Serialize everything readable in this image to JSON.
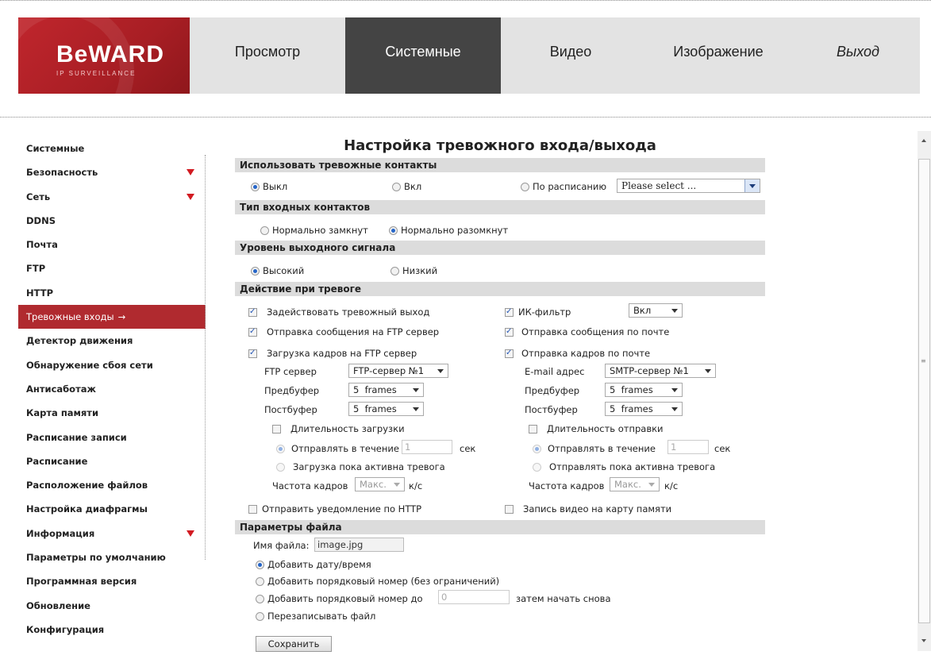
{
  "header": {
    "brand": "BeWARD",
    "tagline": "IP SURVEILLANCE",
    "tabs": [
      {
        "label": "Просмотр"
      },
      {
        "label": "Системные"
      },
      {
        "label": "Видео"
      },
      {
        "label": "Изображение"
      },
      {
        "label": "Выход"
      }
    ]
  },
  "sidebar": {
    "items": [
      {
        "label": "Системные"
      },
      {
        "label": "Безопасность"
      },
      {
        "label": "Сеть"
      },
      {
        "label": "DDNS"
      },
      {
        "label": "Почта"
      },
      {
        "label": "FTP"
      },
      {
        "label": "HTTP"
      },
      {
        "label": "Тревожные входы"
      },
      {
        "label": "Детектор движения"
      },
      {
        "label": "Обнаружение сбоя сети"
      },
      {
        "label": "Антисаботаж"
      },
      {
        "label": "Карта памяти"
      },
      {
        "label": "Расписание записи"
      },
      {
        "label": "Расписание"
      },
      {
        "label": "Расположение файлов"
      },
      {
        "label": "Настройка диафрагмы"
      },
      {
        "label": "Информация"
      },
      {
        "label": "Параметры по умолчанию"
      },
      {
        "label": "Программная версия"
      },
      {
        "label": "Обновление"
      },
      {
        "label": "Конфигурация"
      }
    ],
    "active_arrow": "→"
  },
  "main": {
    "title": "Настройка тревожного входа/выхода",
    "use_contacts": {
      "heading": "Использовать тревожные контакты",
      "off": "Выкл",
      "on": "Вкл",
      "schedule": "По расписанию",
      "schedule_select": "Please select ..."
    },
    "input_type": {
      "heading": "Тип входных контактов",
      "nc": "Нормально замкнут",
      "no": "Нормально разомкнут"
    },
    "output_level": {
      "heading": "Уровень выходного сигнала",
      "high": "Высокий",
      "low": "Низкий"
    },
    "actions": {
      "heading": "Действие при тревоге",
      "alarm_out": "Задействовать тревожный выход",
      "ir_filter": "ИК-фильтр",
      "ir_value": "Вкл",
      "ftp_msg": "Отправка сообщения на FTP сервер",
      "mail_msg": "Отправка сообщения по почте",
      "ftp_upload": "Загрузка кадров на FTP сервер",
      "mail_frames": "Отправка кадров по почте",
      "ftp_server_label": "FTP сервер",
      "ftp_server_value": "FTP-сервер №1",
      "email_label": "E-mail адрес",
      "email_value": "SMTP-сервер №1",
      "prebuffer_label": "Предбуфер",
      "postbuffer_label": "Постбуфер",
      "frames_value": "5  frames",
      "upload_duration": "Длительность загрузки",
      "send_duration": "Длительность отправки",
      "send_during": "Отправлять в течение",
      "seconds_value": "1",
      "sec": "сек",
      "upload_while": "Загрузка пока активна тревога",
      "send_while": "Отправлять пока активна тревога",
      "frame_rate_label": "Частота кадров",
      "frame_rate_value": "Макс.",
      "fps": "к/с",
      "http_notify": "Отправить уведомление по HTTP",
      "sd_record": "Запись видео на карту памяти"
    },
    "file": {
      "heading": "Параметры файла",
      "name_label": "Имя файла:",
      "name_value": "image.jpg",
      "add_datetime": "Добавить дату/время",
      "add_seq_unlimited": "Добавить порядковый номер (без ограничений)",
      "add_seq_to": "Добавить порядковый номер до",
      "seq_value": "0",
      "then_restart": "затем начать снова",
      "overwrite": "Перезаписывать файл"
    },
    "save": "Сохранить"
  }
}
